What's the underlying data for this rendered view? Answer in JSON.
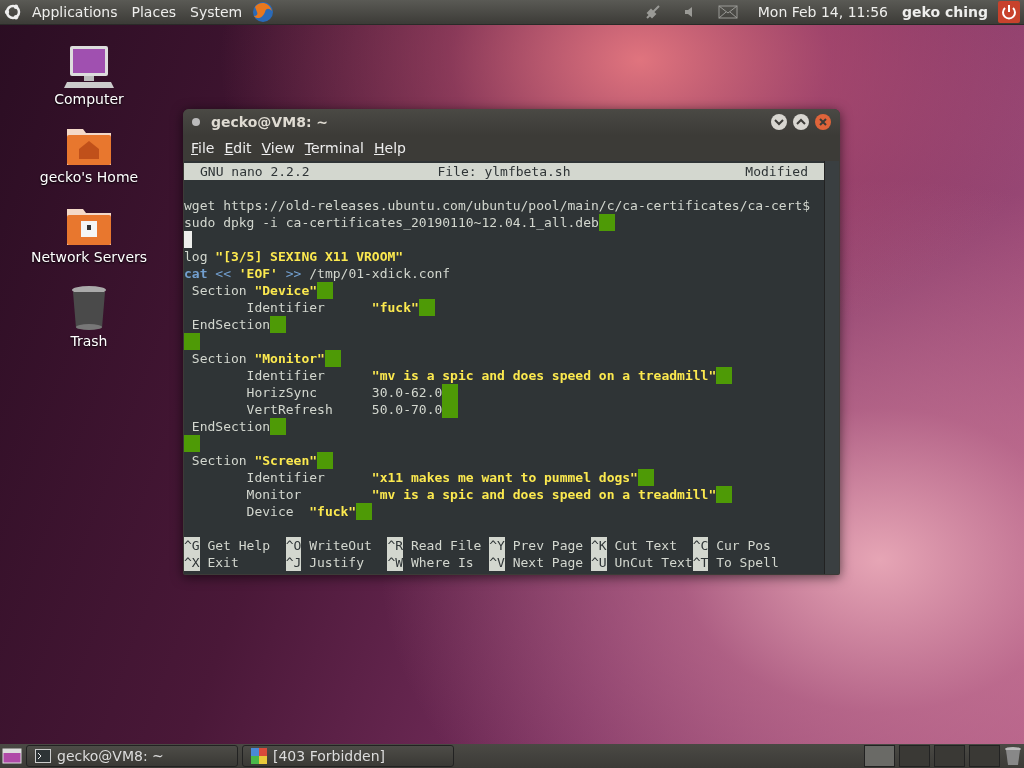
{
  "top_panel": {
    "menus": [
      "Applications",
      "Places",
      "System"
    ],
    "clock": "Mon Feb 14, 11:56",
    "user": "geko ching"
  },
  "desktop_icons": [
    {
      "kind": "computer",
      "label": "Computer"
    },
    {
      "kind": "home",
      "label": "gecko's Home"
    },
    {
      "kind": "network",
      "label": "Network Servers"
    },
    {
      "kind": "trash",
      "label": "Trash"
    }
  ],
  "window": {
    "title": "gecko@VM8: ~",
    "menu": [
      "File",
      "Edit",
      "View",
      "Terminal",
      "Help"
    ],
    "nano": {
      "version": "GNU nano 2.2.2",
      "file": "File: ylmfbeta.sh",
      "status": "Modified",
      "lines": [
        {
          "kind": "blank"
        },
        {
          "kind": "text",
          "segments": [
            {
              "kind": "text",
              "text": "wget https://old-releases.ubuntu.com/ubuntu/pool/main/c/ca-certificates/ca-cert$"
            }
          ]
        },
        {
          "kind": "text",
          "segments": [
            {
              "kind": "text",
              "text": "sudo dpkg -i ca-certificates_20190110~12.04.1_all.deb"
            },
            {
              "kind": "cursor"
            }
          ]
        },
        {
          "kind": "text",
          "segments": [
            {
              "kind": "caret"
            }
          ]
        },
        {
          "kind": "text",
          "segments": [
            {
              "kind": "text",
              "text": "log "
            },
            {
              "kind": "string",
              "text": "\"[3/5] SEXING X11 VROOM\""
            }
          ]
        },
        {
          "kind": "text",
          "segments": [
            {
              "kind": "keyword",
              "text": "cat"
            },
            {
              "kind": "operator",
              "text": " << "
            },
            {
              "kind": "string",
              "text": "'EOF'"
            },
            {
              "kind": "operator",
              "text": " >> "
            },
            {
              "kind": "text",
              "text": "/tmp/01-xdick.conf"
            }
          ]
        },
        {
          "kind": "text",
          "segments": [
            {
              "kind": "text",
              "text": " Section "
            },
            {
              "kind": "string",
              "text": "\"Device\""
            },
            {
              "kind": "cursor"
            }
          ]
        },
        {
          "kind": "text",
          "segments": [
            {
              "kind": "text",
              "text": "        Identifier      "
            },
            {
              "kind": "string",
              "text": "\"fuck\""
            },
            {
              "kind": "cursor"
            }
          ]
        },
        {
          "kind": "text",
          "segments": [
            {
              "kind": "text",
              "text": " EndSection"
            },
            {
              "kind": "cursor"
            }
          ]
        },
        {
          "kind": "text",
          "segments": [
            {
              "kind": "cursor"
            }
          ]
        },
        {
          "kind": "text",
          "segments": [
            {
              "kind": "text",
              "text": " Section "
            },
            {
              "kind": "string",
              "text": "\"Monitor\""
            },
            {
              "kind": "cursor"
            }
          ]
        },
        {
          "kind": "text",
          "segments": [
            {
              "kind": "text",
              "text": "        Identifier      "
            },
            {
              "kind": "string",
              "text": "\"mv is a spic and does speed on a treadmill\""
            },
            {
              "kind": "cursor"
            }
          ]
        },
        {
          "kind": "text",
          "segments": [
            {
              "kind": "text",
              "text": "        HorizSync       30.0-62.0"
            },
            {
              "kind": "cursor"
            }
          ]
        },
        {
          "kind": "text",
          "segments": [
            {
              "kind": "text",
              "text": "        VertRefresh     50.0-70.0"
            },
            {
              "kind": "cursor"
            }
          ]
        },
        {
          "kind": "text",
          "segments": [
            {
              "kind": "text",
              "text": " EndSection"
            },
            {
              "kind": "cursor"
            }
          ]
        },
        {
          "kind": "text",
          "segments": [
            {
              "kind": "cursor"
            }
          ]
        },
        {
          "kind": "text",
          "segments": [
            {
              "kind": "text",
              "text": " Section "
            },
            {
              "kind": "string",
              "text": "\"Screen\""
            },
            {
              "kind": "cursor"
            }
          ]
        },
        {
          "kind": "text",
          "segments": [
            {
              "kind": "text",
              "text": "        Identifier      "
            },
            {
              "kind": "string",
              "text": "\"x11 makes me want to pummel dogs\""
            },
            {
              "kind": "cursor"
            }
          ]
        },
        {
          "kind": "text",
          "segments": [
            {
              "kind": "text",
              "text": "        Monitor         "
            },
            {
              "kind": "string",
              "text": "\"mv is a spic and does speed on a treadmill\""
            },
            {
              "kind": "cursor"
            }
          ]
        },
        {
          "kind": "text",
          "segments": [
            {
              "kind": "text",
              "text": "        Device  "
            },
            {
              "kind": "string",
              "text": "\"fuck\""
            },
            {
              "kind": "cursor"
            }
          ]
        },
        {
          "kind": "blank"
        }
      ],
      "shortcuts": [
        {
          "key": "^G",
          "label": "Get Help"
        },
        {
          "key": "^O",
          "label": "WriteOut"
        },
        {
          "key": "^R",
          "label": "Read File"
        },
        {
          "key": "^Y",
          "label": "Prev Page"
        },
        {
          "key": "^K",
          "label": "Cut Text"
        },
        {
          "key": "^C",
          "label": "Cur Pos"
        },
        {
          "key": "^X",
          "label": "Exit"
        },
        {
          "key": "^J",
          "label": "Justify"
        },
        {
          "key": "^W",
          "label": "Where Is"
        },
        {
          "key": "^V",
          "label": "Next Page"
        },
        {
          "key": "^U",
          "label": "UnCut Text"
        },
        {
          "key": "^T",
          "label": "To Spell"
        }
      ]
    }
  },
  "bottom_panel": {
    "tasks": [
      {
        "kind": "terminal",
        "label": "gecko@VM8: ~"
      },
      {
        "kind": "browser",
        "label": "[403 Forbidden]"
      }
    ],
    "workspaces": [
      {
        "selected": true
      },
      {
        "selected": false
      },
      {
        "selected": false
      },
      {
        "selected": false
      }
    ]
  }
}
